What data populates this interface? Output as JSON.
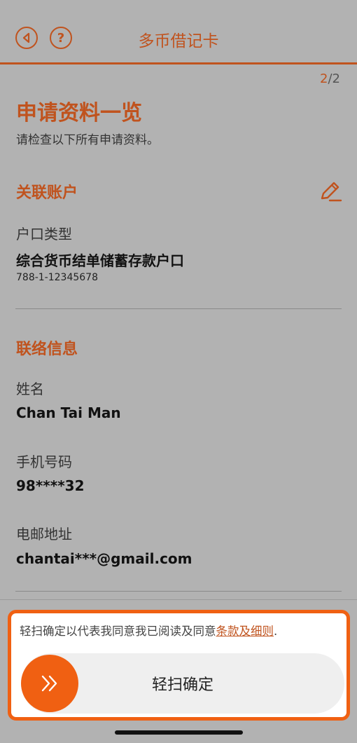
{
  "header": {
    "title": "多币借记卡",
    "back_icon": "back-arrow-icon",
    "help_icon": "question-mark-icon"
  },
  "progress": {
    "current": "2",
    "total": "/2"
  },
  "page": {
    "title": "申请资料一览",
    "subtitle": "请检查以下所有申请资料。"
  },
  "linked_account": {
    "section_title": "关联账户",
    "edit_icon": "pencil-icon",
    "account_type_label": "户口类型",
    "account_type_value": "综合货币结单储蓄存款户口",
    "account_number": "788-1-12345678"
  },
  "contact": {
    "section_title": "联络信息",
    "name_label": "姓名",
    "name_value": "Chan Tai Man",
    "mobile_label": "手机号码",
    "mobile_value": "98****32",
    "email_label": "电邮地址",
    "email_value": "chantai***@gmail.com"
  },
  "confirm": {
    "consent_text": "轻扫确定以代表我同意我已阅读及同意",
    "terms_link": "条款及细则",
    "consent_end": ".",
    "slider_label": "轻扫确定",
    "slider_icon": "double-chevron-right-icon"
  },
  "colors": {
    "accent": "#c0531e",
    "highlight_border": "#f06012",
    "overlay_bg": "#b2b2b2"
  }
}
